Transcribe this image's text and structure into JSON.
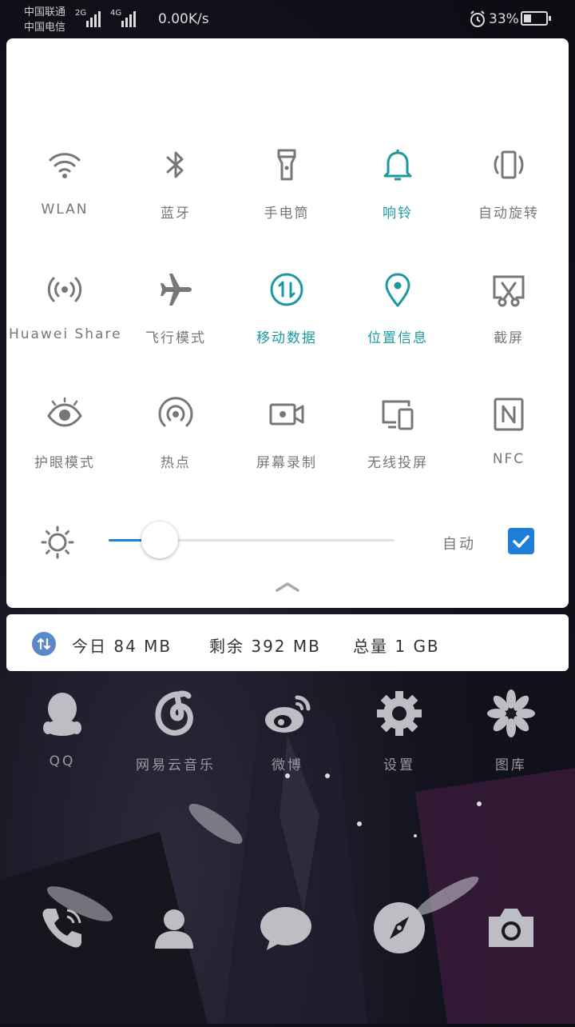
{
  "status_bar": {
    "carrier1": "中国联通",
    "carrier2": "中国电信",
    "net1": "2G",
    "net2": "4G",
    "speed": "0.00K/s",
    "battery": "33%",
    "icons": [
      "signal-icon",
      "alarm-icon",
      "battery-icon"
    ]
  },
  "tiles": [
    {
      "label": "WLAN",
      "icon": "wifi-icon",
      "active": false
    },
    {
      "label": "蓝牙",
      "icon": "bluetooth-icon",
      "active": false
    },
    {
      "label": "手电筒",
      "icon": "flashlight-icon",
      "active": false
    },
    {
      "label": "响铃",
      "icon": "bell-icon",
      "active": true
    },
    {
      "label": "自动旋转",
      "icon": "rotate-icon",
      "active": false
    },
    {
      "label": "Huawei Share",
      "icon": "share-icon",
      "active": false
    },
    {
      "label": "飞行模式",
      "icon": "airplane-icon",
      "active": false
    },
    {
      "label": "移动数据",
      "icon": "mobile-data-icon",
      "active": true
    },
    {
      "label": "位置信息",
      "icon": "location-icon",
      "active": true
    },
    {
      "label": "截屏",
      "icon": "screenshot-icon",
      "active": false
    },
    {
      "label": "护眼模式",
      "icon": "eye-icon",
      "active": false
    },
    {
      "label": "热点",
      "icon": "hotspot-icon",
      "active": false
    },
    {
      "label": "屏幕录制",
      "icon": "screen-record-icon",
      "active": false
    },
    {
      "label": "无线投屏",
      "icon": "cast-icon",
      "active": false
    },
    {
      "label": "NFC",
      "icon": "nfc-icon",
      "active": false
    }
  ],
  "brightness": {
    "level": 0.18,
    "auto_label": "自动",
    "auto_checked": true
  },
  "data_usage": {
    "today": "今日 84 MB",
    "remaining": "剩余 392 MB",
    "total": "总量 1 GB"
  },
  "home_apps": [
    {
      "label": "QQ",
      "icon": "qq-icon"
    },
    {
      "label": "网易云音乐",
      "icon": "netease-music-icon"
    },
    {
      "label": "微博",
      "icon": "weibo-icon"
    },
    {
      "label": "设置",
      "icon": "settings-icon"
    },
    {
      "label": "图库",
      "icon": "gallery-icon"
    }
  ],
  "dock": [
    "phone-icon",
    "contacts-icon",
    "messages-icon",
    "browser-icon",
    "camera-icon"
  ],
  "colors": {
    "active": "#1a9a9f",
    "inactive": "#777777",
    "accent": "#1f7fd6"
  }
}
